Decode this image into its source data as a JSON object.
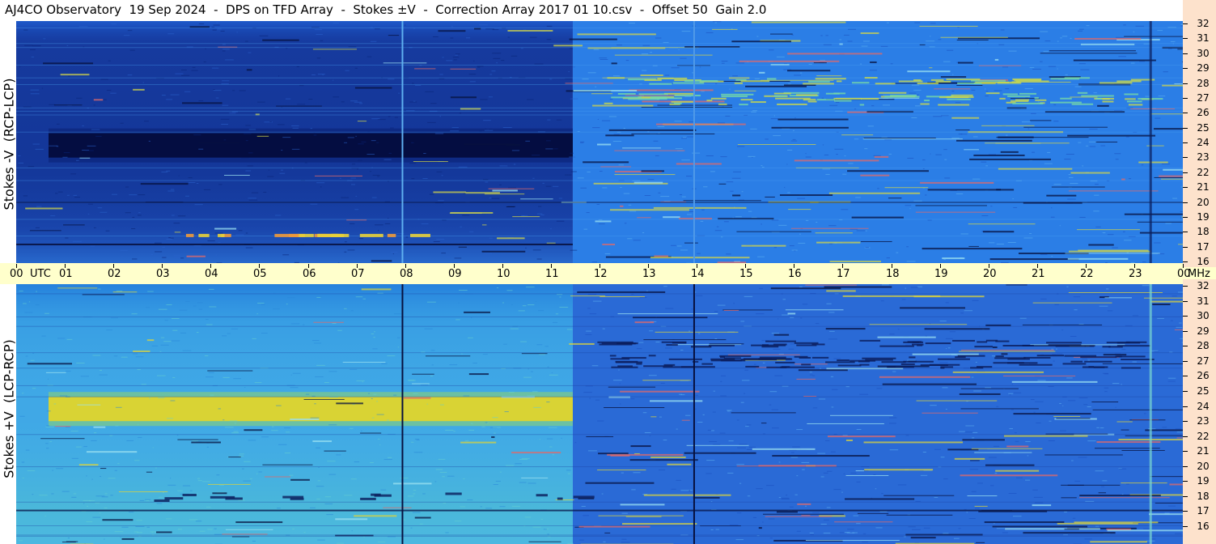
{
  "title": "AJ4CO Observatory  19 Sep 2024  -  DPS on TFD Array  -  Stokes ±V  -  Correction Array 2017 01 10.csv  -  Offset 50  Gain 2.0",
  "time_axis": {
    "labels": [
      "00",
      "UTC",
      "01",
      "02",
      "03",
      "04",
      "05",
      "06",
      "07",
      "08",
      "09",
      "10",
      "11",
      "12",
      "13",
      "14",
      "15",
      "16",
      "17",
      "18",
      "19",
      "20",
      "21",
      "22",
      "23",
      "00",
      "MHz"
    ]
  },
  "chart_data": [
    {
      "type": "heatmap",
      "ylabel": "Stokes -V  (RCP-LCP)",
      "x": [
        "00",
        "01",
        "02",
        "03",
        "04",
        "05",
        "06",
        "07",
        "08",
        "09",
        "10",
        "11",
        "12",
        "13",
        "14",
        "15",
        "16",
        "17",
        "18",
        "19",
        "20",
        "21",
        "22",
        "23",
        "00"
      ],
      "xlabel": "UTC",
      "yticks": [
        "32",
        "31",
        "30",
        "29",
        "28",
        "27",
        "26",
        "25",
        "24",
        "23",
        "22",
        "21",
        "20",
        "19",
        "18",
        "17",
        "16"
      ],
      "yunit": "MHz",
      "ylim": [
        16,
        32
      ],
      "xlim_hours": [
        0,
        24
      ],
      "day_night_transition_hour": 11.45,
      "dark_band_mhz": 23.8,
      "colors": {
        "night_base": "#163a9e",
        "night_band": "#030b3c",
        "day_base": "#2b7ee6",
        "interference_warm": "#cfd34b",
        "interference_dark": "#07113f"
      }
    },
    {
      "type": "heatmap",
      "ylabel": "Stokes +V  (LCP-RCP)",
      "x": [
        "00",
        "01",
        "02",
        "03",
        "04",
        "05",
        "06",
        "07",
        "08",
        "09",
        "10",
        "11",
        "12",
        "13",
        "14",
        "15",
        "16",
        "17",
        "18",
        "19",
        "20",
        "21",
        "22",
        "23",
        "00"
      ],
      "xlabel": "UTC",
      "yticks": [
        "32",
        "31",
        "30",
        "29",
        "28",
        "27",
        "26",
        "25",
        "24",
        "23",
        "22",
        "21",
        "20",
        "19",
        "18",
        "17",
        "16"
      ],
      "yunit": "MHz",
      "ylim": [
        16,
        32
      ],
      "xlim_hours": [
        0,
        24
      ],
      "day_night_transition_hour": 11.45,
      "bright_band_mhz": 23.8,
      "colors": {
        "night_base": "#3fa6e6",
        "night_band": "#e3d52a",
        "day_base": "#2a6ad6",
        "interference_warm": "#d8d23e",
        "interference_dark": "#07113f"
      }
    }
  ]
}
